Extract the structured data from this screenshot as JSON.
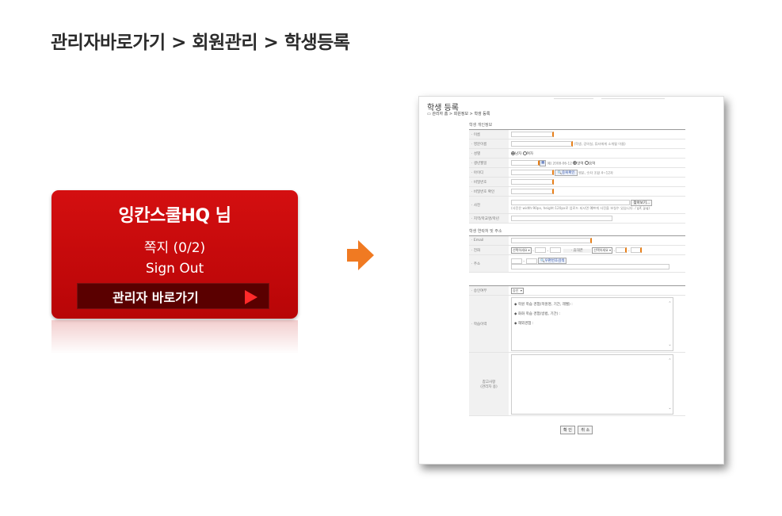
{
  "breadcrumb": "관리자바로가기 > 회원관리 > 학생등록",
  "card": {
    "user_name": "잉칸스쿨HQ 님",
    "messages": "쪽지 (0/2)",
    "sign_out": "Sign Out",
    "admin_link": "관리자 바로가기"
  },
  "colors": {
    "card_red": "#c40a0b",
    "arrow_orange": "#f07a22"
  },
  "form": {
    "title": "학생 등록",
    "location": "관리자 홈 > 회원정보 > 학생 등록",
    "section_personal": "학생 개인정보",
    "labels": {
      "name": "이름",
      "english_name": "영문이름",
      "gender": "성별",
      "birth": "생년월일",
      "id": "아이디",
      "password": "비밀번호",
      "password_confirm": "비밀번호 확인",
      "photo": "사진",
      "region": "지역/학교명/학년"
    },
    "english_hint": "(학생, 강의실, 튜터에게 소개될 이름)",
    "gender_male": "남자",
    "gender_female": "여자",
    "birth_hint": "예) 2008-06-12",
    "calendar_solar": "양력",
    "calendar_lunar": "음력",
    "id_check_button": "중복확인",
    "id_hint": "영문, 숫자 조합 4~12자",
    "photo_button": "찾아보기...",
    "photo_hint": "(사진은 width:90px, height:120px로 업로드 되시면 예쁘게 사진을 보실수 있습니다. / gif, jpg)",
    "section_contact": "학생 연락처 및 주소",
    "labels_contact": {
      "email": "Email",
      "phone": "전화",
      "mobile": "휴대폰",
      "address": "주소"
    },
    "phone_select": "선택하세요",
    "mobile_select": "선택하세요",
    "zip_button": "우편번호검색",
    "labels_admin": {
      "approval": "승인여부",
      "history": "학습이력",
      "note": "참고사항\n(관리자 용)"
    },
    "approval_value": "승인",
    "history_lines": [
      "◆ 학원 학습 경험(학원명, 기간, 레벨) :",
      "◆ 화화 학습 경험(방법, 기간) :",
      "◆ 해외경험 :"
    ],
    "confirm_button": "확 인",
    "cancel_button": "취 소"
  }
}
